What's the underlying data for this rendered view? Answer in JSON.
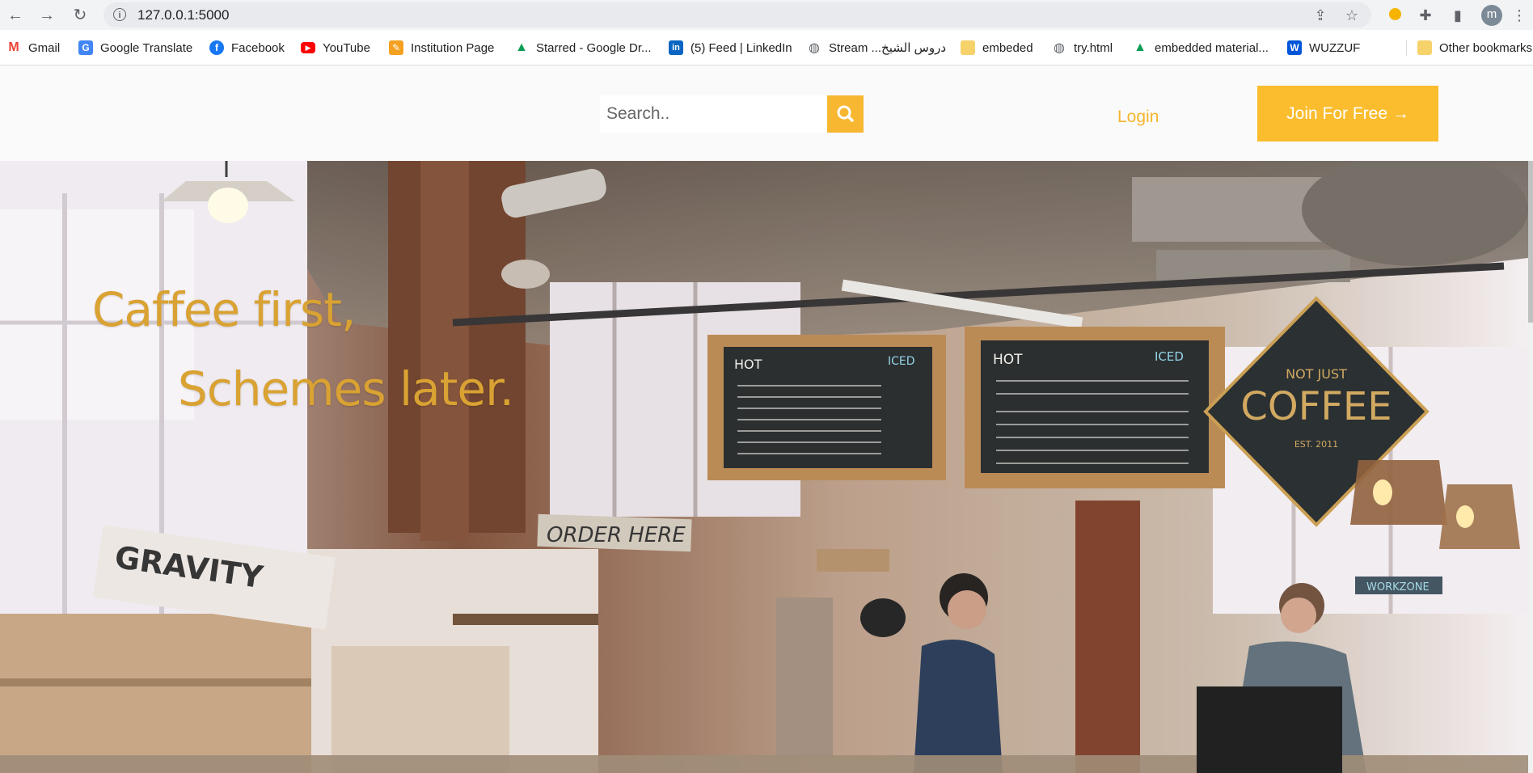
{
  "browser": {
    "url": "127.0.0.1:5000",
    "profile_initial": "m"
  },
  "bookmarks": [
    {
      "label": "Gmail",
      "icon": "gmail-icon",
      "color": "#ea4335"
    },
    {
      "label": "Google Translate",
      "icon": "translate-icon",
      "color": "#4285f4"
    },
    {
      "label": "Facebook",
      "icon": "facebook-icon",
      "color": "#1877f2"
    },
    {
      "label": "YouTube",
      "icon": "youtube-icon",
      "color": "#ff0000"
    },
    {
      "label": "Institution Page",
      "icon": "pencil-icon",
      "color": "#f4a020"
    },
    {
      "label": "Starred - Google Dr...",
      "icon": "google-drive-icon",
      "color": "#0f9d58"
    },
    {
      "label": "(5) Feed | LinkedIn",
      "icon": "linkedin-icon",
      "color": "#0a66c2"
    },
    {
      "label": "Stream ...دروس الشيخ",
      "icon": "globe-icon",
      "color": "#5f6368"
    },
    {
      "label": "embeded",
      "icon": "folder-icon",
      "color": "#f6d26b"
    },
    {
      "label": "try.html",
      "icon": "globe-icon",
      "color": "#5f6368"
    },
    {
      "label": "embedded material...",
      "icon": "google-drive-icon",
      "color": "#0f9d58"
    },
    {
      "label": "WUZZUF",
      "icon": "wuzzuf-icon",
      "color": "#0055d9"
    }
  ],
  "other_bookmarks": "Other bookmarks",
  "header": {
    "search_placeholder": "Search..",
    "login_label": "Login",
    "join_label": "Join For Free →"
  },
  "hero": {
    "line1": "Caffee first,",
    "line2": "Schemes later.",
    "menu_board_left_title": "HOT",
    "menu_board_left_iced": "ICED",
    "menu_board_right_title": "HOT",
    "menu_board_right_iced": "ICED",
    "sign_top": "NOT JUST",
    "sign_main": "COFFEE",
    "sign_bottom": "EST. 2011",
    "order_sign": "ORDER HERE",
    "box_brand": "GRAVITY",
    "workzone_sign": "WORKZONE"
  },
  "colors": {
    "accent": "#fbbc2e",
    "headline": "#d9a232"
  }
}
